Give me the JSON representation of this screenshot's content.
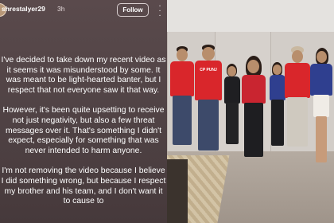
{
  "story": {
    "username": "shrestalyer29",
    "time": "3h",
    "follow_label": "Follow",
    "paragraphs": [
      "I've decided to take down my recent video as it seems it was misunderstood by some. It was meant to be light-hearted banter, but I respect that not everyone saw it that way.",
      "However, it's been quite upsetting to receive not just negativity, but also a few threat messages over it. That's something I didn't expect, especially for something that was never intended to harm anyone.",
      "I'm not removing the video because I believe I did something wrong, but because I respect my brother and his team, and I don't want it to cause to"
    ],
    "icons": {
      "more": "more-icon",
      "avatar": "avatar"
    }
  },
  "photo": {
    "jersey_label": "CP PUNJ",
    "colors": {
      "jersey_red": "#d9262b",
      "jersey_blue": "#2f3f8f"
    }
  }
}
